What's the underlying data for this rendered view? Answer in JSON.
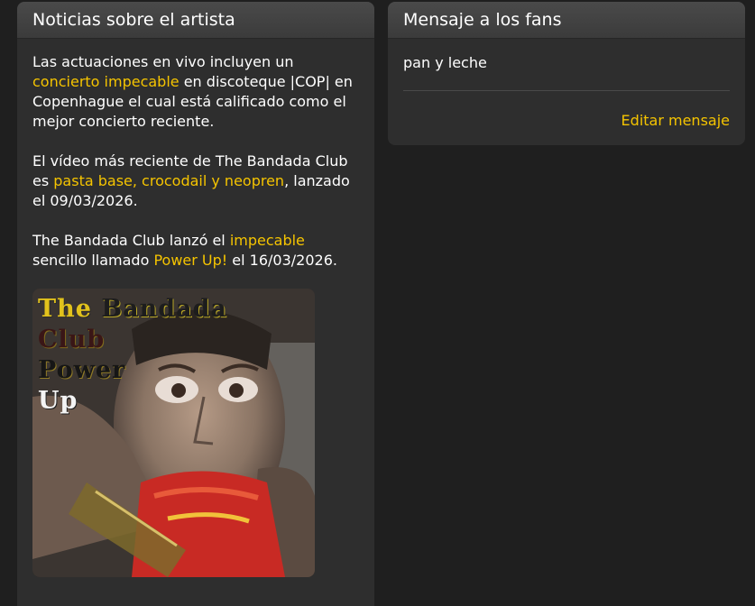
{
  "news_panel": {
    "title": "Noticias sobre el artista",
    "p1": {
      "before": "Las actuaciones en vivo incluyen un ",
      "highlight": "concierto impecable",
      "after": " en discoteque |COP| en Copenhague el cual está calificado como el mejor concierto reciente."
    },
    "p2": {
      "before": "El vídeo más reciente de The Bandada Club es ",
      "highlight": "pasta base, crocodail y neopren",
      "after": ", lanzado el 09/03/2026."
    },
    "p3": {
      "before": "The Bandada Club lanzó el ",
      "highlight1": "impecable",
      "middle": " sencillo llamado ",
      "highlight2": "Power Up!",
      "after": " el 16/03/2026."
    },
    "cover_art": {
      "line1_a": "The",
      "line1_b": "Bandada",
      "line2": "Club",
      "line3": "Power",
      "line4": "Up"
    }
  },
  "fans_panel": {
    "title": "Mensaje a los fans",
    "message": "pan y leche",
    "edit_label": "Editar mensaje"
  },
  "colors": {
    "background": "#1f1f1f",
    "panel": "#2e2e2e",
    "accent": "#f5c400"
  }
}
